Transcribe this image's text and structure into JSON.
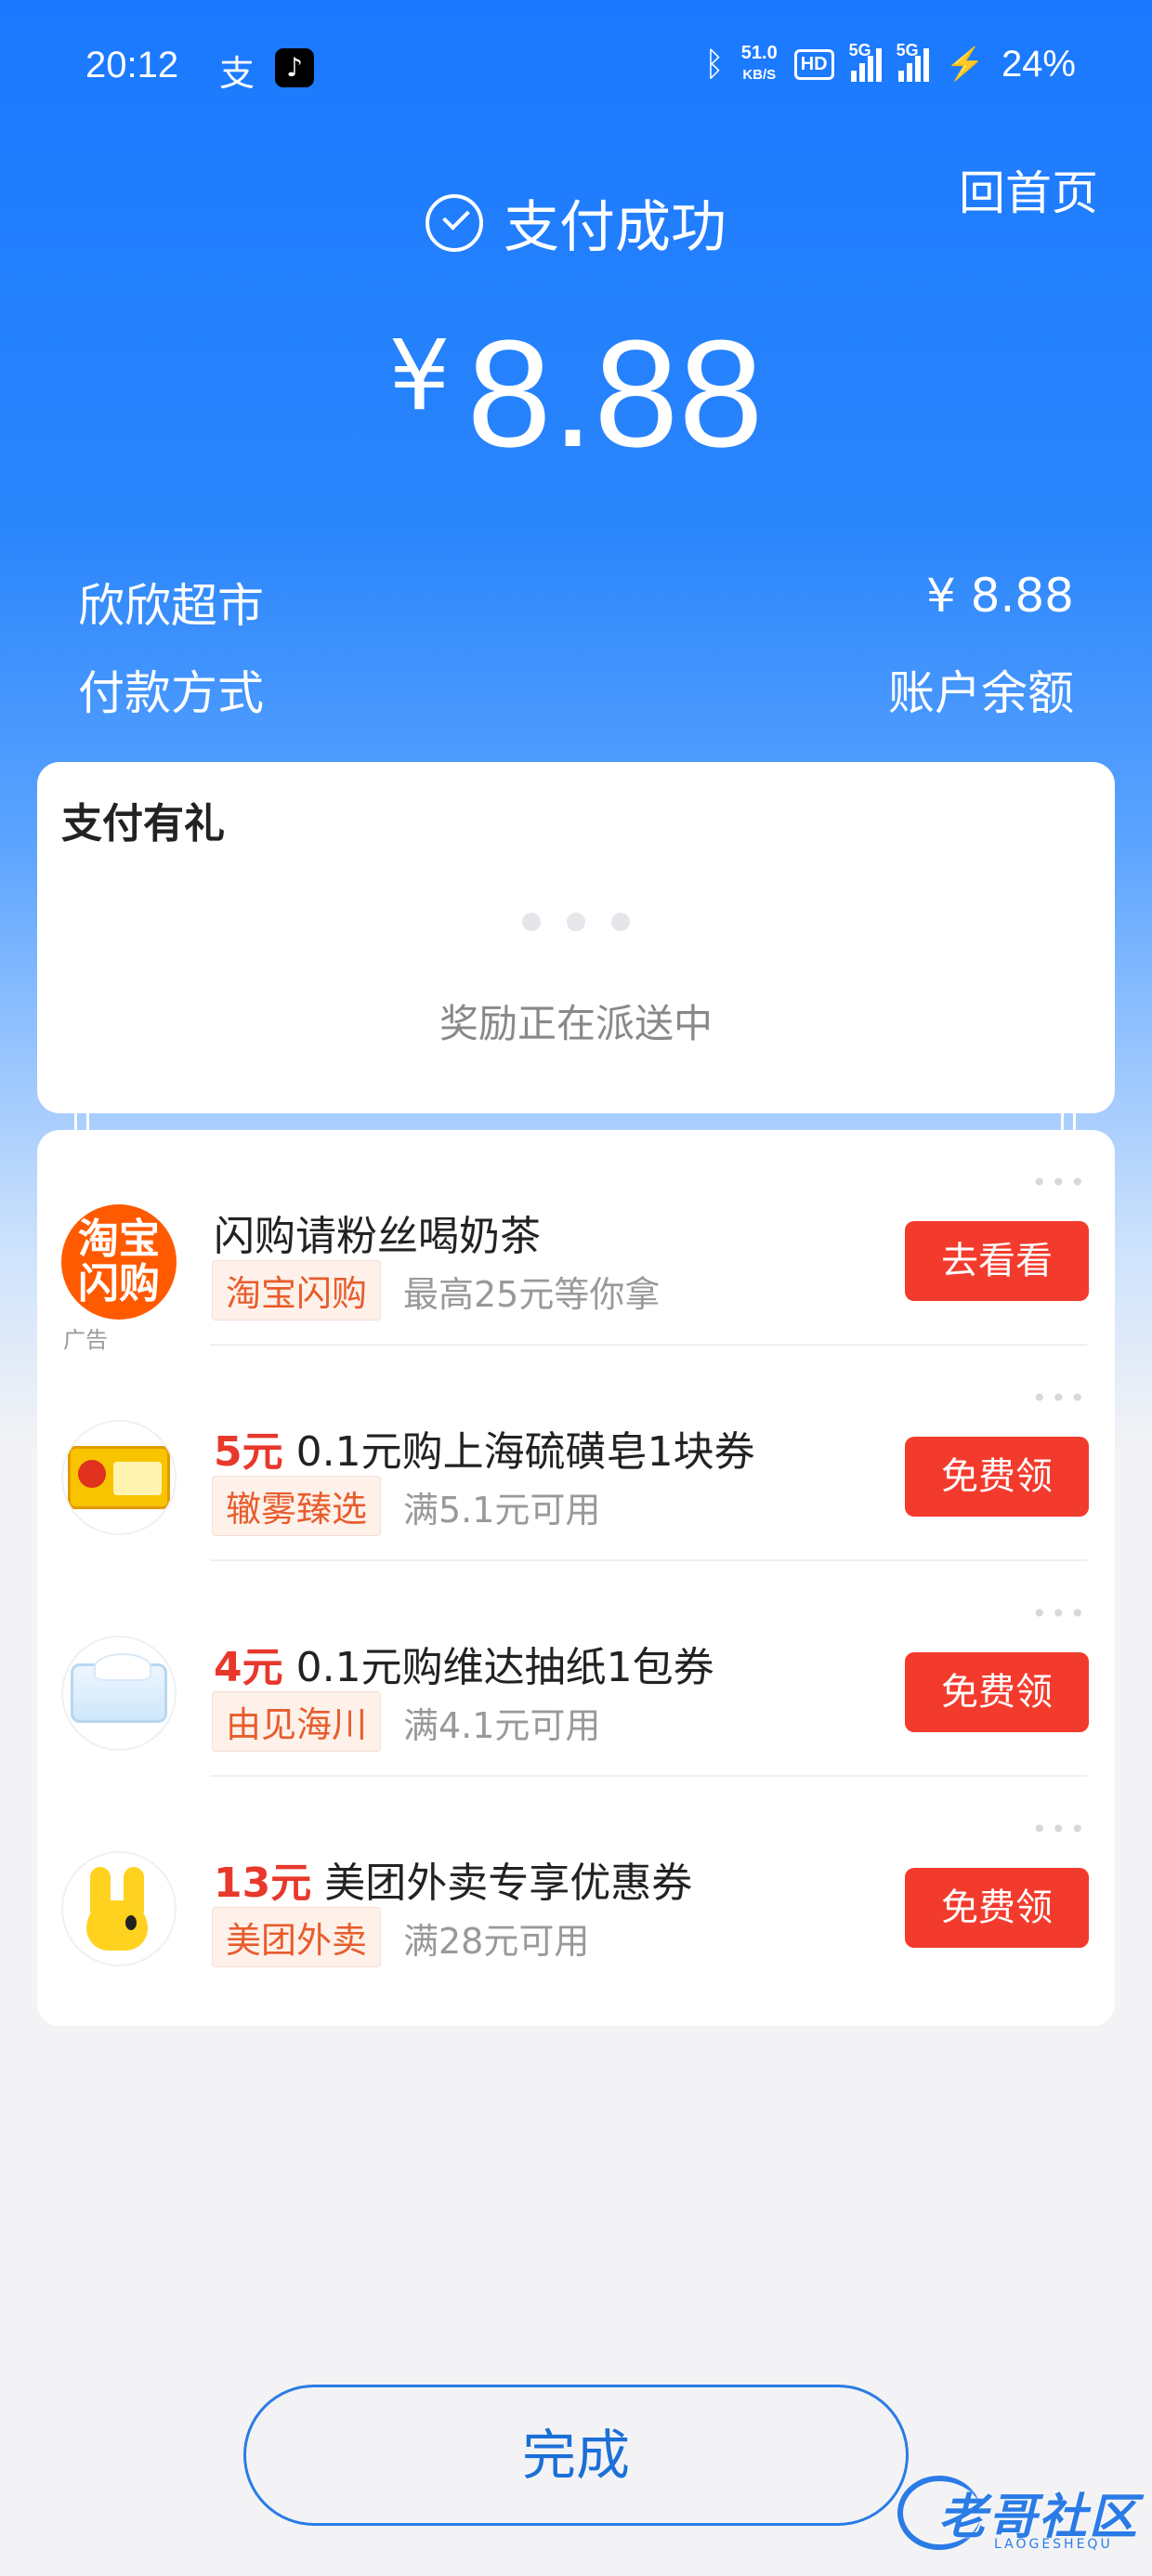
{
  "status_bar": {
    "time": "20:12",
    "net_speed": "51.0",
    "net_unit": "KB/S",
    "hd": "HD",
    "sim1": "5G",
    "sim2": "5G",
    "battery": "24%"
  },
  "header": {
    "home_label": "回首页",
    "status_text": "支付成功",
    "currency_symbol": "¥",
    "amount": "8.88"
  },
  "summary": {
    "merchant": "欣欣超市",
    "merchant_amount": "¥ 8.88",
    "pay_method_label": "付款方式",
    "pay_method_value": "账户余额"
  },
  "gift": {
    "title": "支付有礼",
    "status": "奖励正在派送中"
  },
  "offers": [
    {
      "logo_text": "淘宝闪购",
      "price": "",
      "title": "闪购请粉丝喝奶茶",
      "tag": "淘宝闪购",
      "sub": "最高25元等你拿",
      "button": "去看看",
      "ad": "广告"
    },
    {
      "price": "5元",
      "title": "0.1元购上海硫磺皂1块券",
      "tag": "辙雾臻选",
      "sub": "满5.1元可用",
      "button": "免费领"
    },
    {
      "price": "4元",
      "title": "0.1元购维达抽纸1包券",
      "tag": "由见海川",
      "sub": "满4.1元可用",
      "button": "免费领"
    },
    {
      "price": "13元",
      "title": "美团外卖专享优惠券",
      "tag": "美团外卖",
      "sub": "满28元可用",
      "button": "免费领"
    }
  ],
  "footer": {
    "done_label": "完成",
    "watermark": "老哥社区",
    "watermark_sub": "LAOGESHEQU"
  },
  "colors": {
    "primary_blue": "#1a79ff",
    "button_red": "#f33b2d",
    "price_red": "#e8382c",
    "tag_orange": "#e85c2c"
  }
}
